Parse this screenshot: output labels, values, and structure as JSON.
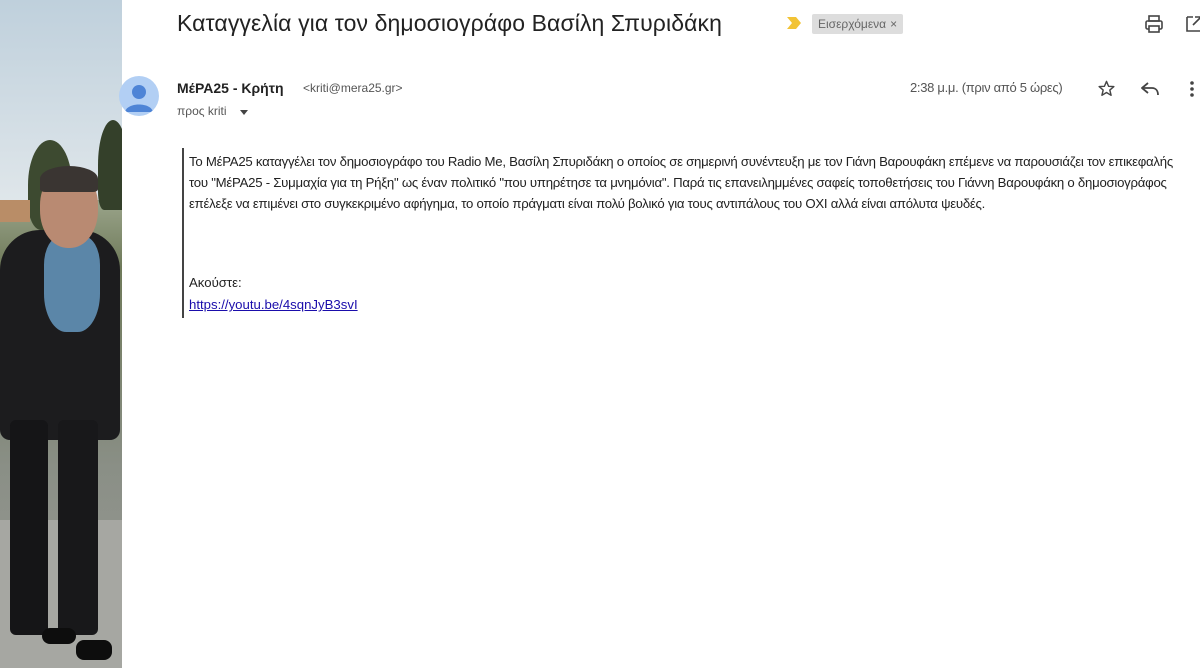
{
  "email": {
    "subject": "Καταγγελία για τον δημοσιογράφο Βασίλη Σπυριδάκη",
    "label": "Εισερχόμενα",
    "label_close": "×",
    "sender_name": "ΜέΡΑ25 - Κρήτη",
    "sender_email": "<kriti@mera25.gr>",
    "to_text": "προς kriti",
    "timestamp": "2:38 μ.μ. (πριν από 5 ώρες)",
    "body_paragraph": "Το ΜέΡΑ25 καταγγέλει τον δημοσιογράφο του Radio Me, Βασίλη Σπυριδάκη ο οποίος σε σημερινή συνέντευξη με τον Γιάνη Βαρουφάκη επέμενε να παρουσιάζει τον επικεφαλής του \"ΜέΡΑ25 - Συμμαχία για τη Ρήξη\" ως έναν πολιτικό \"που υπηρέτησε τα μνημόνια\". Παρά τις επανειλημμένες σαφείς τοποθετήσεις του Γιάννη Βαρουφάκη ο δημοσιογράφος επέλεξε να επιμένει στο συγκεκριμένο αφήγημα, το οποίο πράγματι είναι πολύ βολικό για τους αντιπάλους του ΟΧΙ αλλά είναι απόλυτα ψευδές.",
    "listen_label": "Ακούστε:",
    "link": "https://youtu.be/4sqnJyB3svI"
  },
  "icons": {
    "importance": "importance-marker-icon",
    "print": "print-icon",
    "new_window": "open-in-new-window-icon",
    "avatar": "default-avatar-icon",
    "star": "star-icon",
    "reply": "reply-icon",
    "more": "more-vertical-icon",
    "caret": "caret-down-icon"
  },
  "colors": {
    "importance": "#f2c335",
    "avatar_bg": "#b2cff4",
    "avatar_fg": "#4e84d6",
    "link": "#1a0dab",
    "label_bg": "#dddddd"
  }
}
